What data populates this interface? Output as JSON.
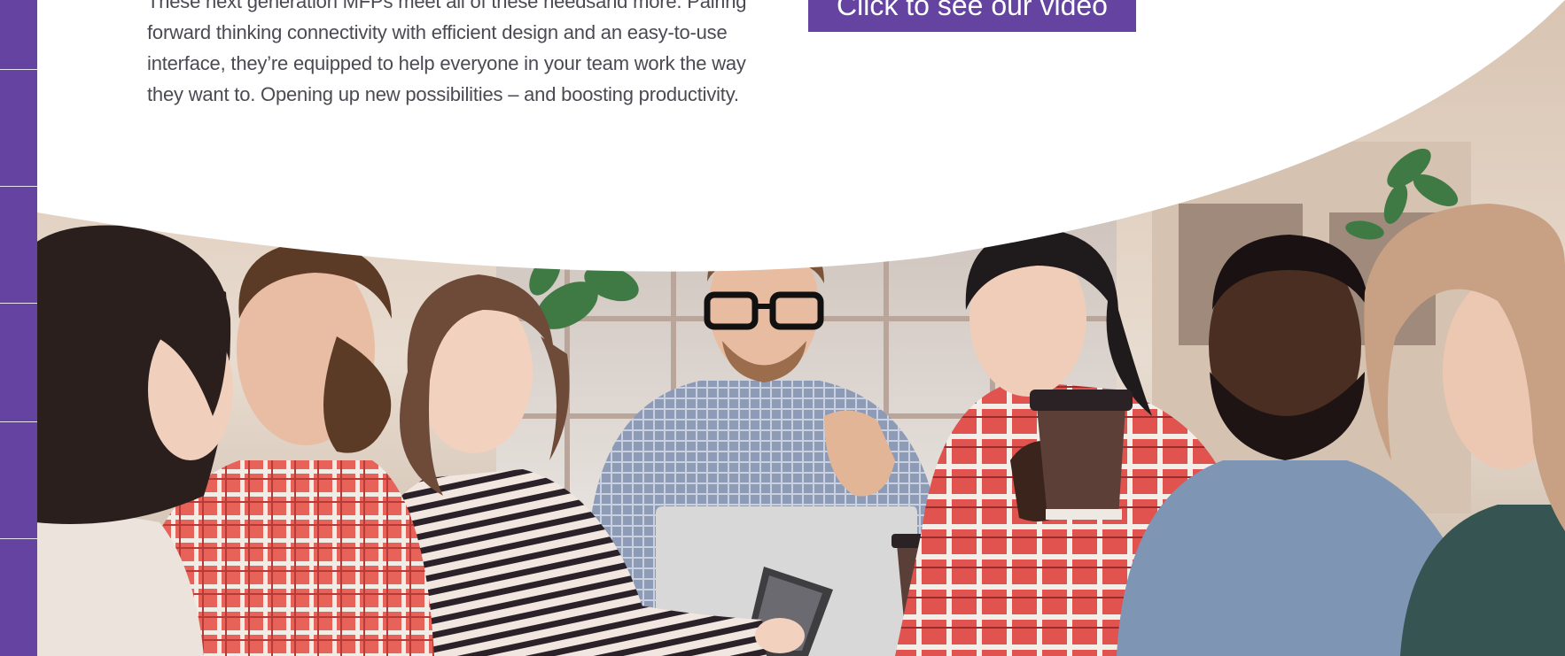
{
  "content": {
    "paragraph_lines": [
      "These next generation MFPs meet all of these needsand more. Pairing",
      "forward thinking connectivity with efficient design and an easy-to-use",
      "interface, they’re equipped  to help everyone in your team work the way",
      "they want to. Opening up new possibilities – and boosting productivity."
    ]
  },
  "cta": {
    "label": "Click to see our video"
  },
  "colors": {
    "brand_purple": "#6444a0",
    "text_gray": "#4a4a52"
  },
  "image": {
    "subject": "team-meeting-photo"
  }
}
